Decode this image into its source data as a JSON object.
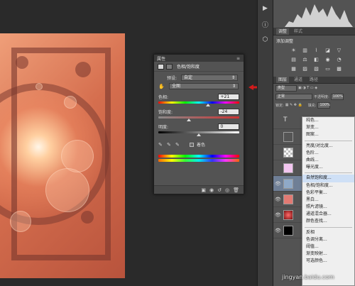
{
  "properties_panel": {
    "tab_label": "属性",
    "title": "色相/饱和度",
    "preset_label": "预设:",
    "preset_value": "自定",
    "channel_value": "全图",
    "hue_label": "色相:",
    "hue_value": "+21",
    "saturation_label": "饱和度:",
    "saturation_value": "-24",
    "lightness_label": "明度:",
    "lightness_value": "0",
    "colorize_label": "着色",
    "hue_fraction": 0.61,
    "saturation_fraction": 0.38,
    "lightness_fraction": 0.5
  },
  "adjustments_panel": {
    "tab_label": "调整",
    "tab_secondary": "样式",
    "add_label": "添加调整"
  },
  "layers_panel": {
    "tab_layers": "图层",
    "tab_channels": "通道",
    "tab_paths": "路径",
    "kind_value": "类型",
    "blend_value": "正常",
    "opacity_label": "不透明度:",
    "opacity_value": "100%",
    "lock_label": "锁定:",
    "fill_label": "填充:",
    "fill_value": "100%",
    "text_layer_glyph": "T"
  },
  "context_menu": {
    "items": [
      "纯色...",
      "渐变...",
      "图案...",
      "亮度/对比度...",
      "色阶...",
      "曲线...",
      "曝光度...",
      "自然饱和度...",
      "色相/饱和度...",
      "色彩平衡...",
      "黑白...",
      "照片滤镜...",
      "通道混合器...",
      "颜色查找...",
      "反相",
      "色调分离...",
      "阈值...",
      "渐变映射...",
      "可选颜色..."
    ],
    "highlighted_index": 7
  },
  "watermark": "jingyan.baidu.com",
  "colors": {
    "accent_arrow": "#d21b1b",
    "panel_bg": "#535353",
    "menu_highlight": "#cfe0f6"
  }
}
